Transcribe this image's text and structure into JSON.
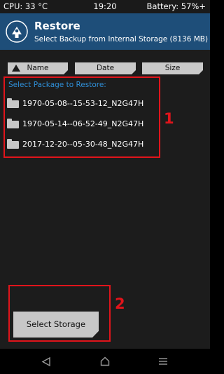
{
  "status_bar": {
    "cpu": "CPU: 33 °C",
    "time": "19:20",
    "battery": "Battery: 57%+"
  },
  "header": {
    "title": "Restore",
    "subtitle": "Select Backup from Internal Storage (8136 MB)"
  },
  "sort": {
    "name_label": "Name",
    "date_label": "Date",
    "size_label": "Size"
  },
  "package_list": {
    "label": "Select Package to Restore:",
    "items": [
      "1970-05-08--15-53-12_N2G47H",
      "1970-05-14--06-52-49_N2G47H",
      "2017-12-20--05-30-48_N2G47H"
    ]
  },
  "annotations": {
    "one": "1",
    "two": "2"
  },
  "select_storage_label": "Select Storage",
  "icons": {
    "app": "twrp-icon",
    "folder": "folder-icon",
    "back": "back-icon",
    "home": "home-icon",
    "menu": "menu-icon"
  },
  "colors": {
    "header_bg": "#1e4e79",
    "list_label": "#2f8fd8",
    "annotation": "#e0141b"
  }
}
